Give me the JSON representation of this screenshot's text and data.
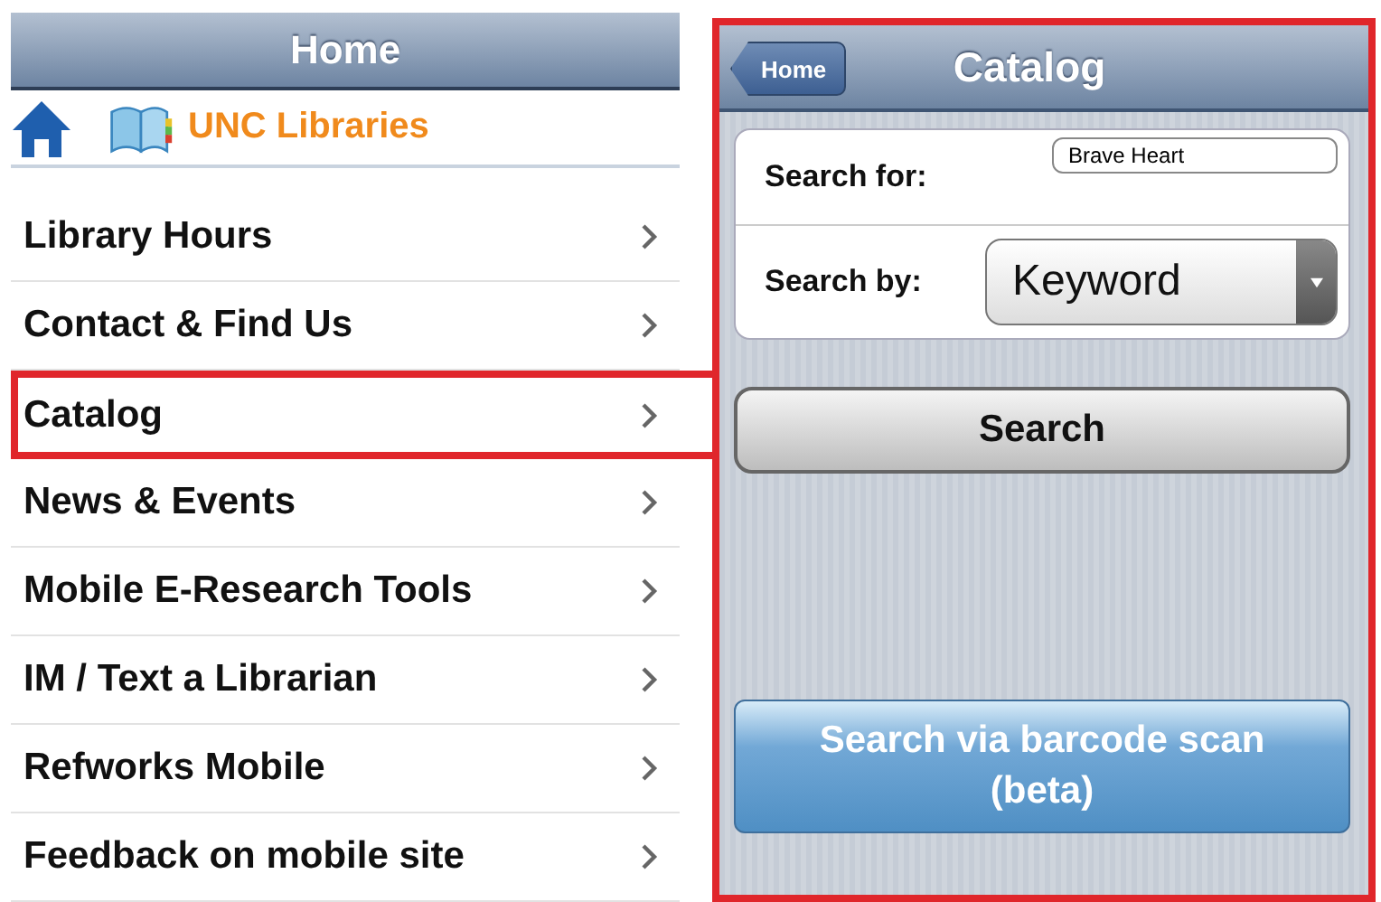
{
  "home_screen": {
    "title": "Home",
    "brand": "UNC Libraries",
    "items": [
      {
        "label": "Library Hours",
        "selected": false
      },
      {
        "label": "Contact & Find Us",
        "selected": false
      },
      {
        "label": "Catalog",
        "selected": true
      },
      {
        "label": "News & Events",
        "selected": false
      },
      {
        "label": "Mobile E-Research Tools",
        "selected": false
      },
      {
        "label": "IM / Text a Librarian",
        "selected": false
      },
      {
        "label": "Refworks Mobile",
        "selected": false
      },
      {
        "label": "Feedback on mobile site",
        "selected": false
      }
    ]
  },
  "catalog_screen": {
    "back_button": "Home",
    "title": "Catalog",
    "highlighted": true,
    "search_for": {
      "label": "Search for:",
      "value": "Brave Heart"
    },
    "search_by": {
      "label": "Search by:",
      "value": "Keyword"
    },
    "search_button": "Search",
    "barcode_button": "Search via barcode scan (beta)"
  }
}
